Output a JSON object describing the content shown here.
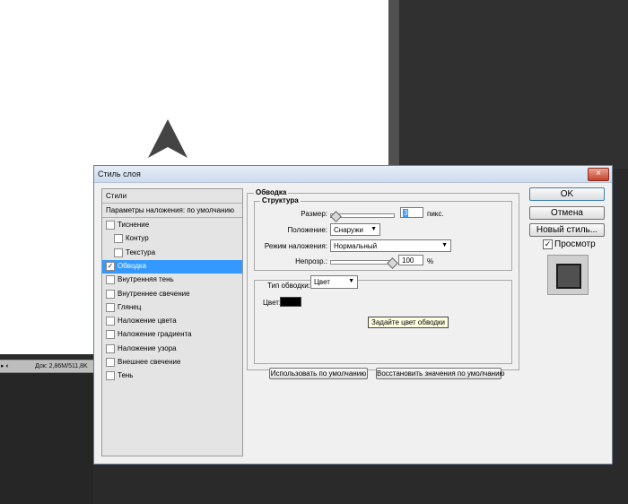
{
  "status_bar": {
    "text": "Док: 2,86M/511,8K"
  },
  "dialog": {
    "title": "Стиль слоя",
    "close_glyph": "×",
    "styles_list": {
      "header": "Стили",
      "blend_options": "Параметры наложения: по умолчанию",
      "items": [
        {
          "label": "Тиснение",
          "checked": false,
          "indent": false
        },
        {
          "label": "Контур",
          "checked": false,
          "indent": true
        },
        {
          "label": "Текстура",
          "checked": false,
          "indent": true
        },
        {
          "label": "Обводка",
          "checked": true,
          "indent": false,
          "selected": true
        },
        {
          "label": "Внутренняя тень",
          "checked": false,
          "indent": false
        },
        {
          "label": "Внутреннее свечение",
          "checked": false,
          "indent": false
        },
        {
          "label": "Глянец",
          "checked": false,
          "indent": false
        },
        {
          "label": "Наложение цвета",
          "checked": false,
          "indent": false
        },
        {
          "label": "Наложение градиента",
          "checked": false,
          "indent": false
        },
        {
          "label": "Наложение узора",
          "checked": false,
          "indent": false
        },
        {
          "label": "Внешнее свечение",
          "checked": false,
          "indent": false
        },
        {
          "label": "Тень",
          "checked": false,
          "indent": false
        }
      ]
    },
    "stroke": {
      "group_title": "Обводка",
      "structure_title": "Структура",
      "size_label": "Размер:",
      "size_value": "3",
      "size_unit": "пикс.",
      "position_label": "Положение:",
      "position_value": "Снаружи",
      "blend_mode_label": "Режим наложения:",
      "blend_mode_value": "Нормальный",
      "opacity_label": "Непрозр.:",
      "opacity_value": "100",
      "opacity_unit": "%",
      "fill_type_label": "Тип обводки:",
      "fill_type_value": "Цвет",
      "color_label": "Цвет:",
      "color_value": "#000000",
      "tooltip": "Задайте цвет обводки",
      "make_default": "Использовать по умолчанию",
      "reset_default": "Восстановить значения по умолчанию"
    },
    "buttons": {
      "ok": "OK",
      "cancel": "Отмена",
      "new_style": "Новый стиль..."
    },
    "preview": {
      "label": "Просмотр",
      "checked": true
    }
  }
}
